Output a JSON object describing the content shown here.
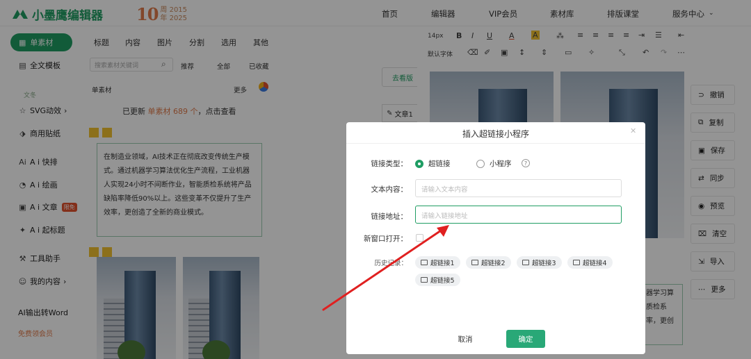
{
  "brand": {
    "name": "小墨鹰编辑器",
    "anniversary_number": "10",
    "anniversary_line1": "周 2015",
    "anniversary_line2": "年 2025"
  },
  "nav": [
    "首页",
    "编辑器",
    "VIP会员",
    "素材库",
    "排版课堂",
    "服务中心"
  ],
  "sidebar": {
    "active_button": "单素材",
    "items": [
      {
        "label": "全文模板"
      },
      {
        "label": "文冬"
      },
      {
        "label": "SVG动效"
      },
      {
        "label": "商用贴纸"
      },
      {
        "label": "A i 快排"
      },
      {
        "label": "A i 绘画"
      },
      {
        "label": "A i 文章",
        "badge": "限免"
      },
      {
        "label": "A i 起标题"
      },
      {
        "label": "工具助手"
      },
      {
        "label": "我的内容"
      },
      {
        "label": "AI输出转Word"
      },
      {
        "label": "免费领会员"
      }
    ]
  },
  "materials": {
    "categories": [
      "标题",
      "内容",
      "图片",
      "分割",
      "选用",
      "其他"
    ],
    "search_placeholder": "搜索素材关键词",
    "filters": [
      "推荐",
      "全部",
      "已收藏"
    ],
    "section_title": "单素材",
    "more": "更多",
    "update_prefix": "已更新",
    "update_link": "单素材 689 个",
    "update_suffix": "，点击查看",
    "card_text": "在制造业领域，AI技术正在彻底改变传统生产模式。通过机器学习算法优化生产流程，工业机器人实现24小时不间断作业，智能质检系统将产品缺陷率降低90%以上。这些变革不仅提升了生产效率，更创造了全新的商业模式。"
  },
  "editor": {
    "font_size": "14px",
    "default_font": "默认字体",
    "side_button": "去看版",
    "article_tab": "文章1",
    "behind_text": "器学习算 质检系 率，更创"
  },
  "actions": [
    "撤销",
    "复制",
    "保存",
    "同步",
    "预览",
    "清空",
    "导入",
    "更多"
  ],
  "dialog": {
    "title": "插入超链接小程序",
    "link_type_label": "链接类型：",
    "option_hyperlink": "超链接",
    "option_miniprogram": "小程序",
    "text_label": "文本内容：",
    "text_placeholder": "请输入文本内容",
    "url_label": "链接地址：",
    "url_placeholder": "请输入链接地址",
    "newwin_label": "新窗口打开：",
    "history_label": "历史记录：",
    "history": [
      "超链接1",
      "超链接2",
      "超链接3",
      "超链接4",
      "超链接5"
    ],
    "cancel": "取消",
    "confirm": "确定"
  },
  "colors": {
    "brand": "#1f9d63",
    "accent": "#e07a4a",
    "arrow": "#e02020"
  }
}
